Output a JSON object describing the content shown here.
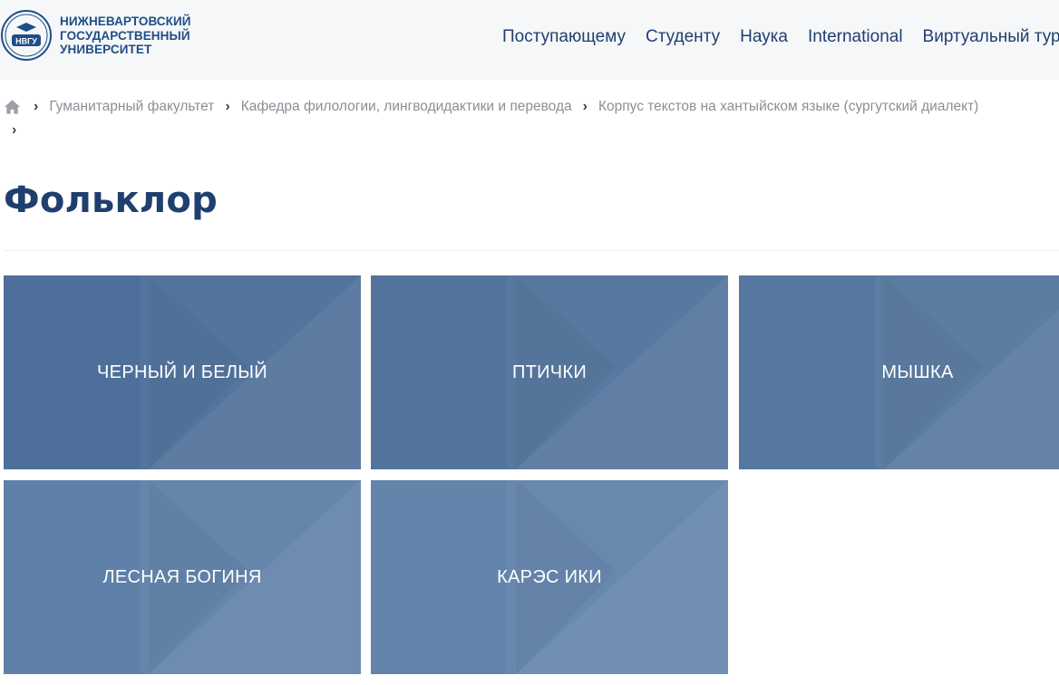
{
  "header": {
    "logo_text": [
      "НИЖНЕВАРТОВСКИЙ",
      "ГОСУДАРСТВЕННЫЙ",
      "УНИВЕРСИТЕТ"
    ],
    "logo_emblem_text": "НВГУ",
    "nav": [
      "Поступающему",
      "Студенту",
      "Наука",
      "International",
      "Виртуальный тур"
    ]
  },
  "breadcrumb": {
    "home_icon": "home-icon",
    "items": [
      "Гуманитарный факультет",
      "Кафедра филологии, лингводидактики и перевода",
      "Корпус текстов на хантыйском языке (сургутский диалект)"
    ],
    "separator": "›"
  },
  "page": {
    "title": "Фольклор"
  },
  "tiles": [
    "ЧЕРНЫЙ И БЕЛЫЙ",
    "ПТИЧКИ",
    "МЫШКА",
    "ЛЕСНАЯ БОГИНЯ",
    "КАРЭС ИКИ"
  ],
  "colors": {
    "tile_row1": "#4e6f99",
    "tile_row2": "#6384ab",
    "heading": "#1f3f6e",
    "header_bg": "#f6f7f9"
  }
}
